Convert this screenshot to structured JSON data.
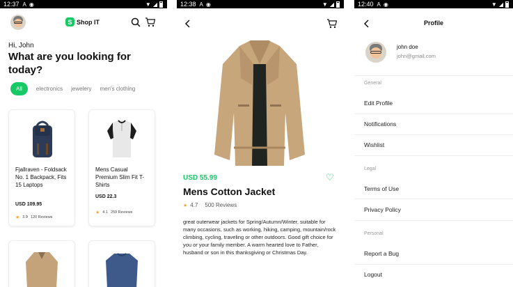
{
  "screens": {
    "home": {
      "status": {
        "time": "12:37",
        "icon_a": "A"
      },
      "logo": {
        "text": "Shop IT",
        "mark": "S"
      },
      "greeting": "Hi, John",
      "headline": "What are you looking for today?",
      "categories": [
        "All",
        "electronics",
        "jewelery",
        "men's clothing"
      ],
      "products": [
        {
          "title": "Fjallraven - Foldsack No. 1 Backpack, Fits 15 Laptops",
          "price": "USD 109.95",
          "rating": "3.9",
          "reviews": "120 Reviews"
        },
        {
          "title": "Mens Casual Premium Slim Fit T-Shirts",
          "price": "USD 22.3",
          "rating": "4.1",
          "reviews": "259 Reviews"
        }
      ]
    },
    "detail": {
      "status": {
        "time": "12:38",
        "icon_a": "A"
      },
      "price": "USD 55.99",
      "title": "Mens Cotton Jacket",
      "rating": "4.7",
      "reviews": "500 Reviews",
      "description": "great outerwear jackets for Spring/Autumn/Winter, suitable for many occasions, such as working, hiking, camping, mountain/rock climbing, cycling, traveling or other outdoors. Good gift choice for you or your family member. A warm hearted love to Father, husband or son in this thanksgiving or Christmas Day."
    },
    "profile": {
      "status": {
        "time": "12:40",
        "icon_a": "A"
      },
      "title": "Profile",
      "name": "john doe",
      "email": "john@gmail.com",
      "sections": {
        "general": "General",
        "legal": "Legal",
        "personal": "Personal"
      },
      "items": {
        "edit_profile": "Edit Profile",
        "notifications": "Notifications",
        "wishlist": "Wishlist",
        "terms": "Terms of Use",
        "privacy": "Privacy Policy",
        "report": "Report a Bug",
        "logout": "Logout"
      }
    }
  },
  "colors": {
    "accent": "#17c964",
    "star": "#f5a623"
  },
  "icons": [
    "avatar",
    "search-icon",
    "cart-icon",
    "back-arrow-icon",
    "heart-icon",
    "star-icon",
    "wifi-icon",
    "signal-icon",
    "battery-icon"
  ]
}
